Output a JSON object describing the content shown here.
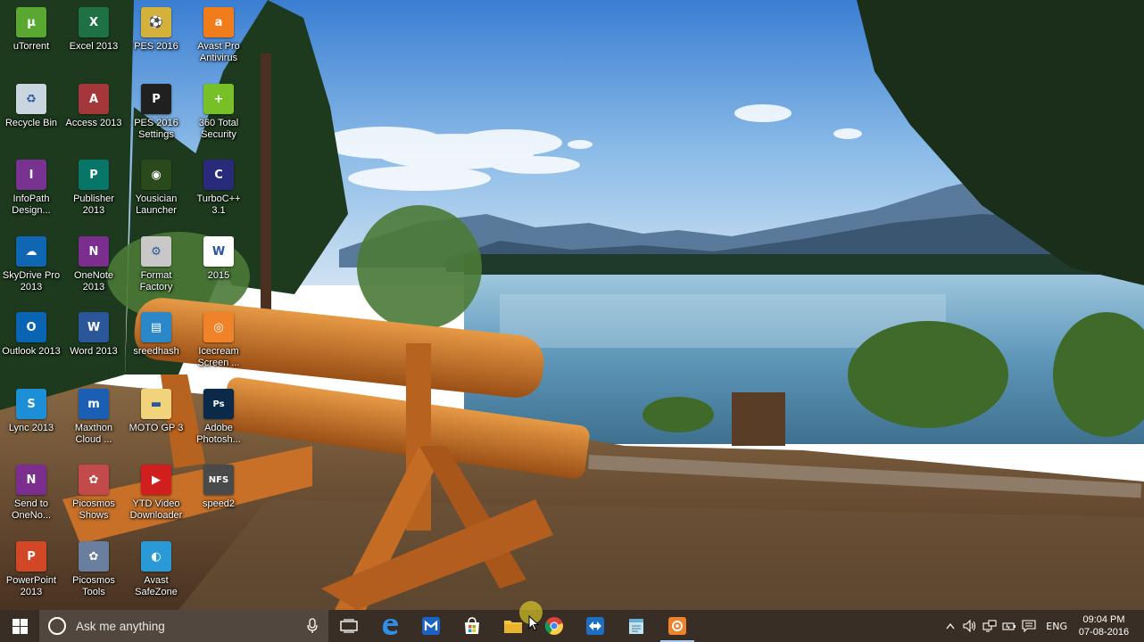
{
  "desktop": {
    "icons": [
      {
        "label": "uTorrent",
        "icon": "utorrent-icon",
        "color": "#5aa832",
        "glyph": "µ"
      },
      {
        "label": "Excel 2013",
        "icon": "excel-icon",
        "color": "#1e7145",
        "glyph": "X"
      },
      {
        "label": "PES 2016",
        "icon": "pes-icon",
        "color": "#d4b13a",
        "glyph": "⚽"
      },
      {
        "label": "Avast Pro\nAntivirus",
        "icon": "avast-icon",
        "color": "#f07c1c",
        "glyph": "a"
      },
      {
        "label": "Recycle Bin",
        "icon": "recycle-bin-icon",
        "color": "#c9d6e0",
        "glyph": "♻"
      },
      {
        "label": "Access 2013",
        "icon": "access-icon",
        "color": "#a4373a",
        "glyph": "A"
      },
      {
        "label": "PES 2016\nSettings",
        "icon": "pes-settings-icon",
        "color": "#202020",
        "glyph": "P"
      },
      {
        "label": "360 Total\nSecurity",
        "icon": "360-security-icon",
        "color": "#78c028",
        "glyph": "+"
      },
      {
        "label": "InfoPath\nDesign...",
        "icon": "infopath-icon",
        "color": "#77338f",
        "glyph": "I"
      },
      {
        "label": "Publisher\n2013",
        "icon": "publisher-icon",
        "color": "#077568",
        "glyph": "P"
      },
      {
        "label": "Yousician\nLauncher",
        "icon": "yousician-icon",
        "color": "#2b4a1c",
        "glyph": "◉"
      },
      {
        "label": "TurboC++\n3.1",
        "icon": "turboc-icon",
        "color": "#2a2a7a",
        "glyph": "C"
      },
      {
        "label": "SkyDrive Pro\n2013",
        "icon": "skydrive-icon",
        "color": "#0f66b3",
        "glyph": "☁"
      },
      {
        "label": "OneNote\n2013",
        "icon": "onenote-icon",
        "color": "#7b2e8e",
        "glyph": "N"
      },
      {
        "label": "Format\nFactory",
        "icon": "format-factory-icon",
        "color": "#c8c8c8",
        "glyph": "⚙"
      },
      {
        "label": "2015",
        "icon": "word-document-icon",
        "color": "#ffffff",
        "glyph": "W"
      },
      {
        "label": "Outlook 2013",
        "icon": "outlook-icon",
        "color": "#0a64b4",
        "glyph": "O"
      },
      {
        "label": "Word 2013",
        "icon": "word-icon",
        "color": "#2b579a",
        "glyph": "W"
      },
      {
        "label": "sreedhash",
        "icon": "user-folder-icon",
        "color": "#2a88c9",
        "glyph": "▤"
      },
      {
        "label": "Icecream\nScreen ...",
        "icon": "icecream-icon",
        "color": "#f0822a",
        "glyph": "◎"
      },
      {
        "label": "Lync 2013",
        "icon": "lync-icon",
        "color": "#1c8fd6",
        "glyph": "S"
      },
      {
        "label": "Maxthon\nCloud ...",
        "icon": "maxthon-icon",
        "color": "#1a5fb4",
        "glyph": "m"
      },
      {
        "label": "MOTO GP 3",
        "icon": "folder-icon",
        "color": "#f0d37a",
        "glyph": "▬"
      },
      {
        "label": "Adobe\nPhotosh...",
        "icon": "photoshop-icon",
        "color": "#0b2a4a",
        "glyph": "Ps"
      },
      {
        "label": "Send to\nOneNo...",
        "icon": "send-onenote-icon",
        "color": "#7b2e8e",
        "glyph": "N"
      },
      {
        "label": "Picosmos\nShows",
        "icon": "picosmos-shows-icon",
        "color": "#c24a4a",
        "glyph": "✿"
      },
      {
        "label": "YTD Video\nDownloader",
        "icon": "ytd-icon",
        "color": "#d11f1f",
        "glyph": "▶"
      },
      {
        "label": "speed2",
        "icon": "nfs-icon",
        "color": "#4a4a4a",
        "glyph": "NFS"
      },
      {
        "label": "PowerPoint\n2013",
        "icon": "powerpoint-icon",
        "color": "#d24726",
        "glyph": "P"
      },
      {
        "label": "Picosmos\nTools",
        "icon": "picosmos-tools-icon",
        "color": "#6a7fa0",
        "glyph": "✿"
      },
      {
        "label": "Avast\nSafeZone",
        "icon": "avast-safezone-icon",
        "color": "#2a9ad6",
        "glyph": "◐"
      }
    ]
  },
  "taskbar": {
    "search_placeholder": "Ask me anything",
    "apps": [
      {
        "name": "task-view",
        "icon": "task-view-icon",
        "active": false
      },
      {
        "name": "edge",
        "icon": "edge-icon",
        "active": false
      },
      {
        "name": "maxthon",
        "icon": "maxthon-icon",
        "active": false
      },
      {
        "name": "store",
        "icon": "store-icon",
        "active": false
      },
      {
        "name": "file-explorer",
        "icon": "folder-icon",
        "active": false
      },
      {
        "name": "chrome",
        "icon": "chrome-icon",
        "active": false
      },
      {
        "name": "teamviewer",
        "icon": "teamviewer-icon",
        "active": false
      },
      {
        "name": "notepad",
        "icon": "notepad-icon",
        "active": false
      },
      {
        "name": "icecream",
        "icon": "icecream-icon",
        "active": true
      }
    ],
    "tray": {
      "language": "ENG",
      "time": "09:04 PM",
      "date": "07-08-2016"
    }
  },
  "colors": {
    "taskbar": "#2b1e13",
    "sky_top": "#3c7fd0",
    "lake": "#5a8fb0",
    "accent": "#a7c8ef"
  }
}
